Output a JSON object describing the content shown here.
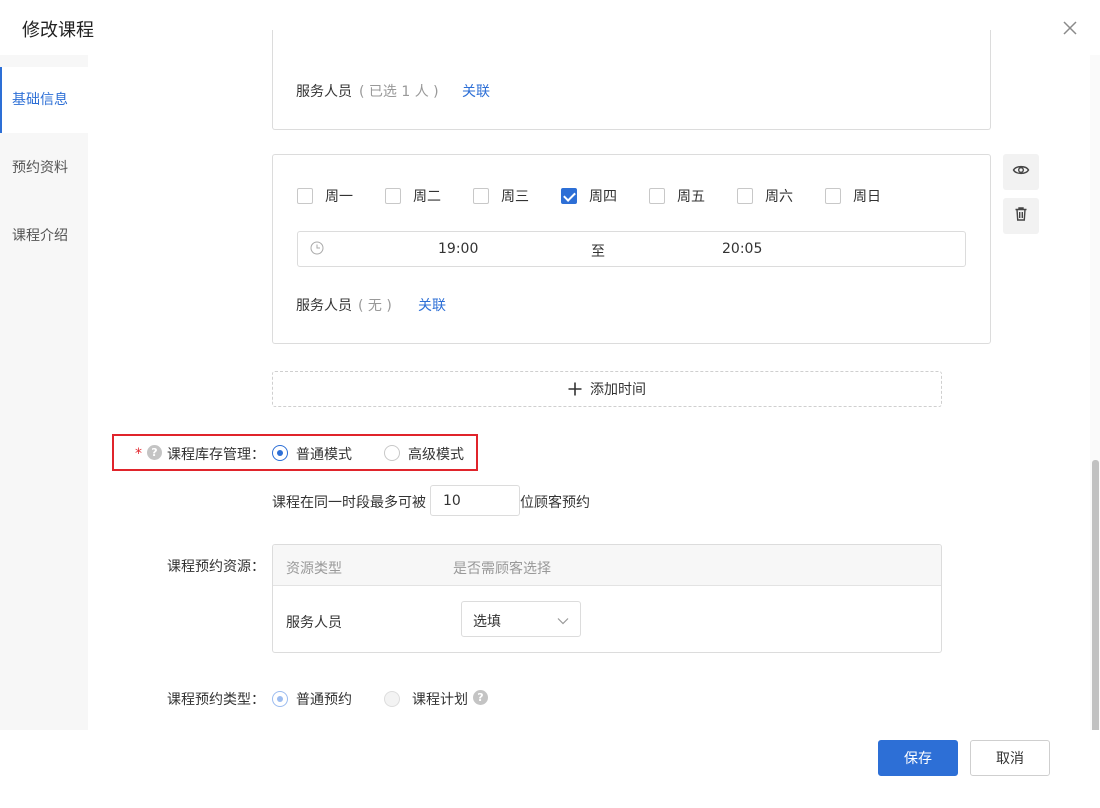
{
  "dialog": {
    "title": "修改课程"
  },
  "sidebar": {
    "items": [
      {
        "label": "基础信息",
        "active": true
      },
      {
        "label": "预约资料",
        "active": false
      },
      {
        "label": "课程介绍",
        "active": false
      }
    ]
  },
  "slot_top": {
    "service_label": "服务人员",
    "service_count": "( 已选 1 人 )",
    "link": "关联"
  },
  "slot_main": {
    "weekdays": [
      {
        "label": "周一",
        "checked": false
      },
      {
        "label": "周二",
        "checked": false
      },
      {
        "label": "周三",
        "checked": false
      },
      {
        "label": "周四",
        "checked": true
      },
      {
        "label": "周五",
        "checked": false
      },
      {
        "label": "周六",
        "checked": false
      },
      {
        "label": "周日",
        "checked": false
      }
    ],
    "time_start": "19:00",
    "time_sep": "至",
    "time_end": "20:05",
    "service_label": "服务人员",
    "service_count": "( 无 )",
    "link": "关联"
  },
  "add_time_label": "添加时间",
  "inventory": {
    "required_mark": "*",
    "label": "课程库存管理：",
    "options": [
      {
        "label": "普通模式",
        "selected": true
      },
      {
        "label": "高级模式",
        "selected": false
      }
    ],
    "capacity_prefix": "课程在同一时段最多可被",
    "capacity_value": "10",
    "capacity_suffix": "位顾客预约"
  },
  "resources": {
    "label": "课程预约资源：",
    "columns": [
      "资源类型",
      "是否需顾客选择"
    ],
    "rows": [
      {
        "type": "服务人员",
        "choice": "选填"
      }
    ]
  },
  "booking_type": {
    "label": "课程预约类型：",
    "options": [
      {
        "label": "普通预约",
        "selected": true
      },
      {
        "label": "课程计划",
        "selected": false
      }
    ]
  },
  "footer": {
    "save": "保存",
    "cancel": "取消"
  },
  "colors": {
    "accent": "#2d6fd6",
    "highlight_border": "#e0242b"
  }
}
